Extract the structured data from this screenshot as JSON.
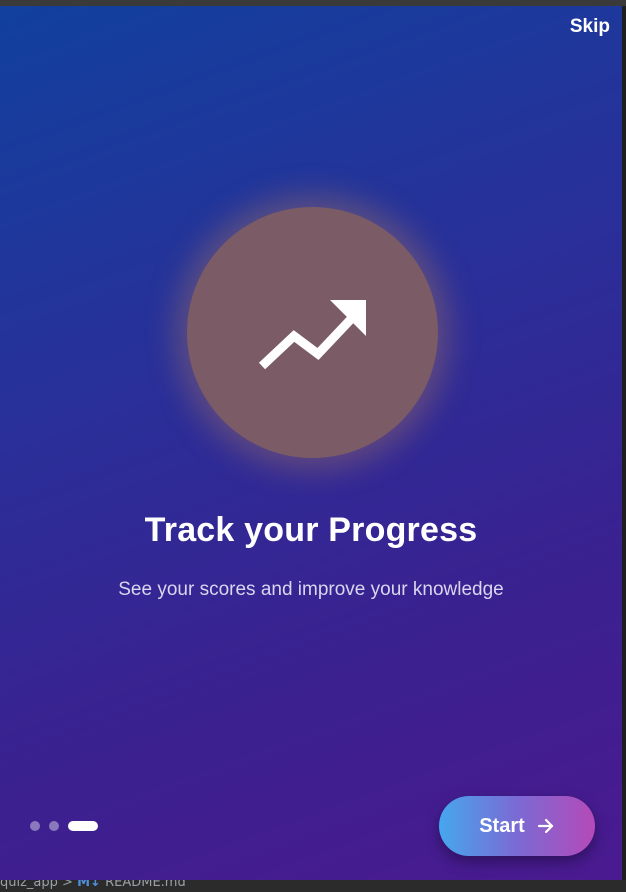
{
  "onboarding": {
    "skip_label": "Skip",
    "title": "Track your Progress",
    "subtitle": "See your scores and improve your knowledge",
    "icon": "trending-up-icon",
    "page_indicator": {
      "total": 3,
      "active_index": 2
    },
    "start_label": "Start",
    "start_icon": "arrow-right-icon"
  },
  "editor_breadcrumb": {
    "folder": "quiz_app",
    "separator": ">",
    "file_badge": "M↓",
    "file": "README.md"
  },
  "colors": {
    "background_start": "#11409e",
    "background_end": "#4a1a90",
    "glow_circle": "#7a5b66",
    "button_start": "#46a7ee",
    "button_end": "#b54ab8"
  }
}
